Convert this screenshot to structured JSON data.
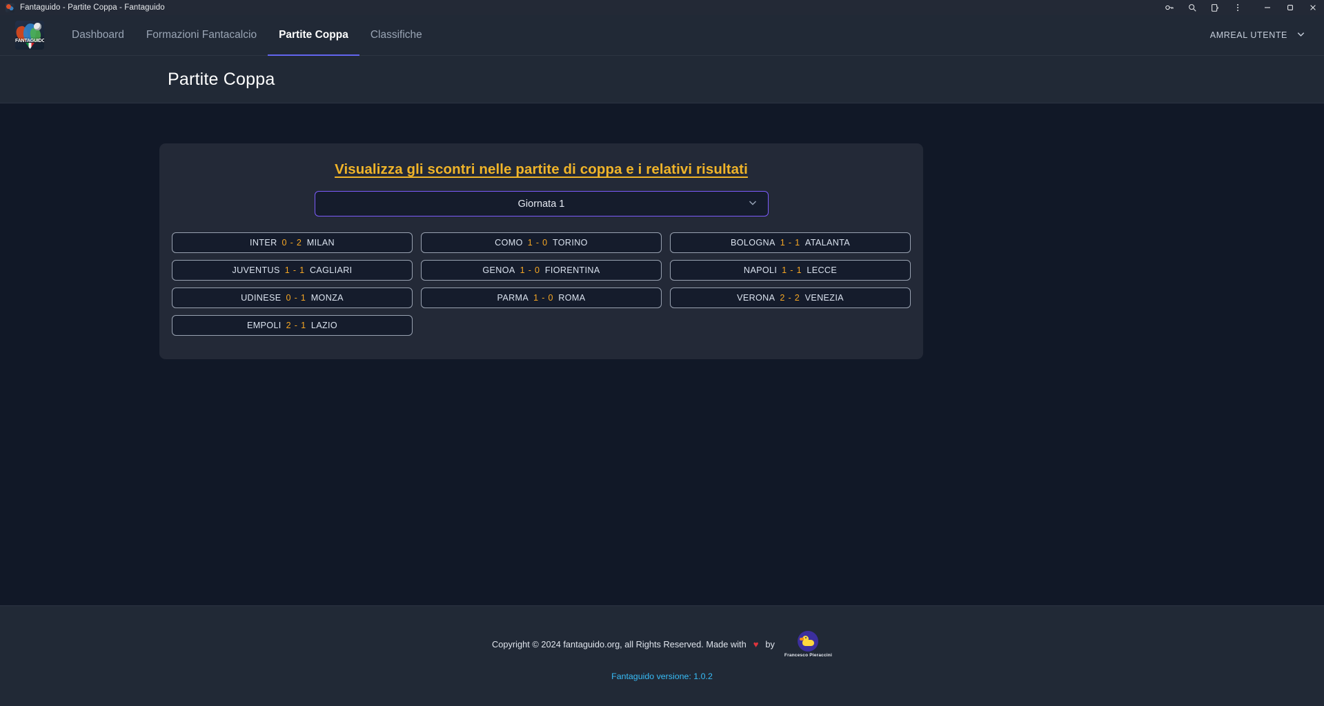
{
  "browser": {
    "tab_title": "Fantaguido - Partite Coppa - Fantaguido",
    "controls": {
      "passwords": "key-icon",
      "zoom": "search-icon",
      "extensions": "extensions-icon",
      "menu": "three-dot-menu-icon",
      "minimize": "minimize-icon",
      "maximize": "maximize-icon",
      "close": "close-icon"
    }
  },
  "navbar": {
    "brand_word": "FANTAGUIDO",
    "links": [
      {
        "label": "Dashboard",
        "active": false
      },
      {
        "label": "Formazioni Fantacalcio",
        "active": false
      },
      {
        "label": "Partite Coppa",
        "active": true
      },
      {
        "label": "Classifiche",
        "active": false
      }
    ],
    "user": {
      "label": "AMREAL UTENTE",
      "chevron": "chevron-down-icon"
    }
  },
  "page": {
    "title": "Partite Coppa"
  },
  "panel": {
    "heading": "Visualizza gli scontri nelle partite di coppa e i relativi risultati",
    "matchday_select": {
      "value": "Giornata 1",
      "chevron": "chevron-down-icon"
    },
    "matches": [
      {
        "home": "INTER",
        "score": "0 - 2",
        "away": "MILAN"
      },
      {
        "home": "COMO",
        "score": "1 - 0",
        "away": "TORINO"
      },
      {
        "home": "BOLOGNA",
        "score": "1 - 1",
        "away": "ATALANTA"
      },
      {
        "home": "JUVENTUS",
        "score": "1 - 1",
        "away": "CAGLIARI"
      },
      {
        "home": "GENOA",
        "score": "1 - 0",
        "away": "FIORENTINA"
      },
      {
        "home": "NAPOLI",
        "score": "1 - 1",
        "away": "LECCE"
      },
      {
        "home": "UDINESE",
        "score": "0 - 1",
        "away": "MONZA"
      },
      {
        "home": "PARMA",
        "score": "1 - 0",
        "away": "ROMA"
      },
      {
        "home": "VERONA",
        "score": "2 - 2",
        "away": "VENEZIA"
      },
      {
        "home": "EMPOLI",
        "score": "2 - 1",
        "away": "LAZIO"
      }
    ]
  },
  "footer": {
    "copyright": "Copyright © 2024 fantaguido.org, all Rights Reserved. Made with",
    "heart": "♥",
    "by": "by",
    "author_name": "Francesco Pieraccini",
    "version": "Fantaguido versione: 1.0.2"
  },
  "colors": {
    "background": "#111827",
    "surface": "#212936",
    "panel": "#232937",
    "accent_gold": "#f0b429",
    "accent_orange": "#f5a623",
    "accent_purple": "#7c5cfc",
    "link_blue": "#38bdf8"
  }
}
